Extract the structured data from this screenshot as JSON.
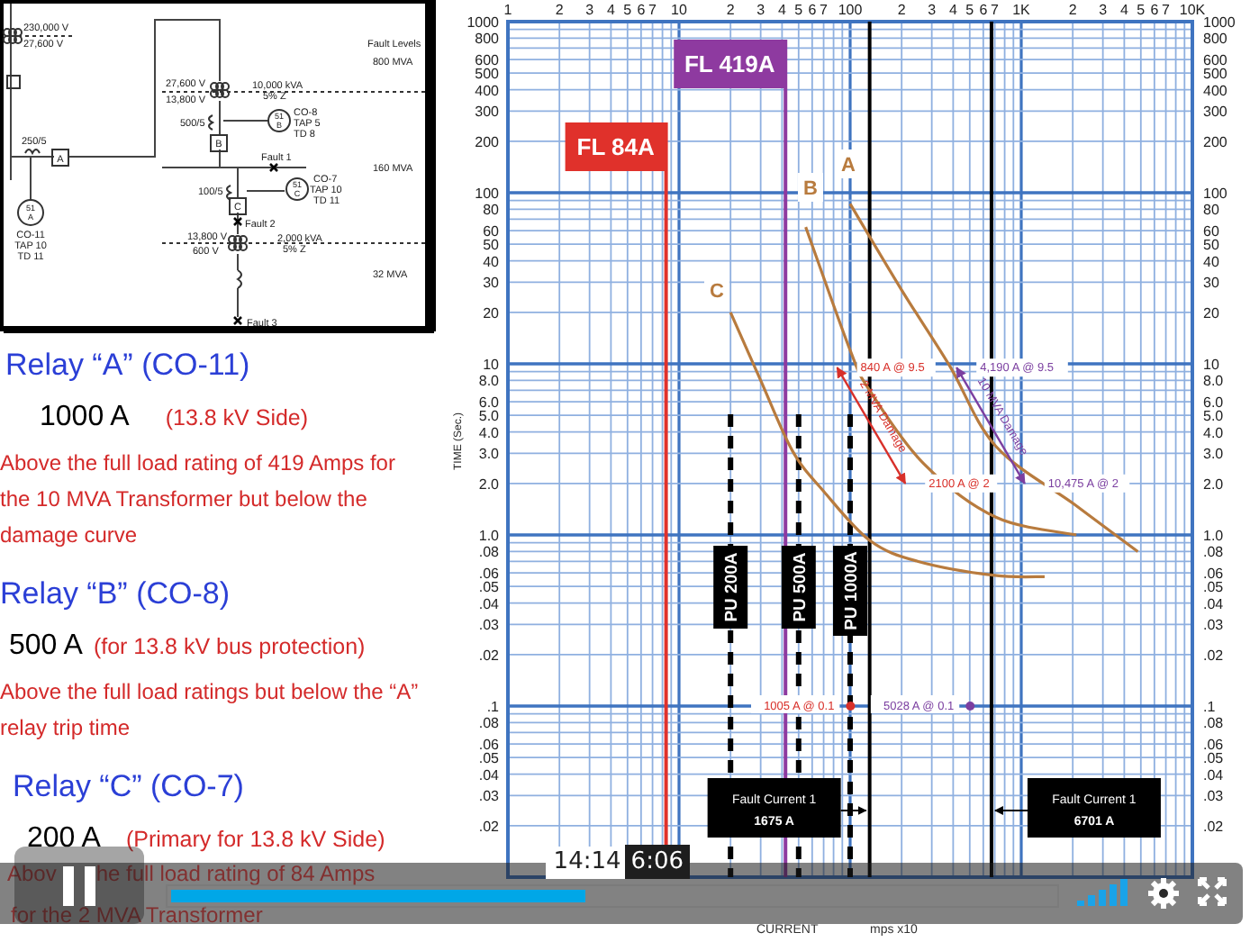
{
  "one_line_diagram": {
    "labels": [
      "230,000 V",
      "27,600 V",
      "Fault Levels",
      "800 MVA",
      "27,600 V",
      "13,800 V",
      "10,000 kVA",
      "5% Z",
      "500/5",
      "CO-8",
      "TAP 5",
      "TD 8",
      "B",
      "Fault 1",
      "250/5",
      "A",
      "160 MVA",
      "100/5",
      "CO-7",
      "TAP 10",
      "TD 11",
      "C",
      "Fault 2",
      "13,800 V",
      "600 V",
      "2,000 kVA",
      "5% Z",
      "32 MVA",
      "CO-11",
      "TAP 10",
      "TD 11",
      "Fault 3",
      "51",
      "A",
      "51",
      "B",
      "51",
      "C"
    ]
  },
  "relays": [
    {
      "title": "Relay “A” (CO-11)",
      "pickup": "1000 A",
      "note": "(13.8 kV Side)",
      "description": "Above the full load rating of 419 Amps for the 10 MVA Transformer but below the damage curve"
    },
    {
      "title": "Relay “B” (CO-8)",
      "pickup": "500 A",
      "note": "(for 13.8 kV bus protection)",
      "description": "Above the full load ratings but below the “A” relay trip time"
    },
    {
      "title": "Relay “C” (CO-7)",
      "pickup": "200 A",
      "note": "(Primary for 13.8 kV Side)",
      "fragments": [
        "Abov",
        "he full load rating of  84 Amps",
        "for the 2 MVA Transformer"
      ]
    }
  ],
  "graph": {
    "y_axis_title": "TIME (Sec.)",
    "x_axis_title": "CURRENT",
    "axis_note": "mps x10",
    "top_scale_labels": [
      "1",
      "2",
      "3",
      "4",
      "5",
      "6",
      "7",
      "10",
      "2",
      "3",
      "4",
      "5",
      "6",
      "7",
      "100",
      "2",
      "3",
      "4",
      "5",
      "6",
      "7",
      "1K",
      "2",
      "3",
      "4",
      "5",
      "6",
      "7",
      "10K"
    ],
    "left_scale_labels": [
      "1000",
      "800",
      "600",
      "500",
      "400",
      "300",
      "200",
      "100",
      "80",
      "60",
      "50",
      "40",
      "30",
      "20",
      "10",
      "8.0",
      "6.0",
      "5.0",
      "4.0",
      "3.0",
      "2.0",
      "1.0",
      ".08",
      ".06",
      ".05",
      ".04",
      ".03",
      ".02",
      ".1",
      ".08",
      ".06",
      ".05",
      ".04",
      ".03",
      ".02"
    ],
    "right_scale_labels": [
      "1000",
      "800",
      "600",
      "500",
      "400",
      "300",
      "200",
      "100",
      "80",
      "60",
      "50",
      "40",
      "30",
      "20",
      "10",
      "8.0",
      "6.0",
      "5.0",
      "4.0",
      "3.0",
      "2.0",
      "1.0",
      ".08",
      ".06",
      ".05",
      ".04",
      ".03",
      ".02",
      ".1",
      ".08",
      ".06",
      ".05",
      ".04",
      ".03",
      ".02"
    ],
    "curves": [
      "A",
      "B",
      "C"
    ],
    "full_load_lines": [
      {
        "label": "FL 84A",
        "color": "#e0312b"
      },
      {
        "label": "FL 419A",
        "color": "#8e3aa0"
      }
    ],
    "pickup_lines": [
      "PU 200A",
      "PU 500A",
      "PU 1000A"
    ],
    "damage_lines": [
      {
        "name": "2 MVA Damage",
        "color": "#d8302a",
        "start_label": "840 A @ 9.5",
        "end_label": "2100 A @ 2"
      },
      {
        "name": "10 MVA Damage",
        "color": "#7b3fa0",
        "start_label": "4,190 A @ 9.5",
        "end_label": "10,475 A @ 2"
      }
    ],
    "point_labels": [
      {
        "text": "1005 A @ 0.1",
        "color": "#d8302a"
      },
      {
        "text": "5028 A @ 0.1",
        "color": "#7b3fa0"
      }
    ],
    "fault_boxes": [
      {
        "title": "Fault Current 1",
        "value": "1675 A"
      },
      {
        "title": "Fault Current 1",
        "value": "6701 A"
      }
    ]
  },
  "player": {
    "playing": true,
    "level": 0.47,
    "hover_time": "14:14",
    "time": "6:06"
  }
}
